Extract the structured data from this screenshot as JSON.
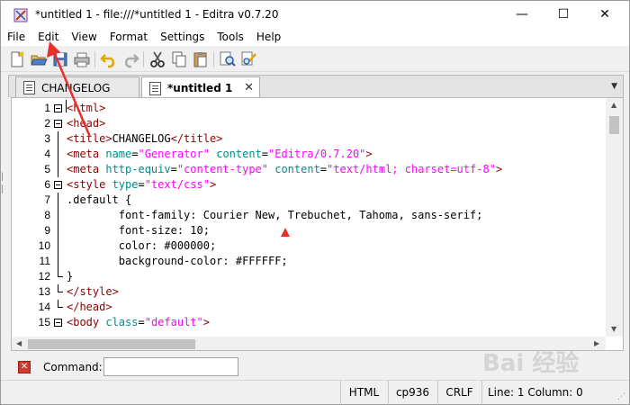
{
  "window": {
    "title": "*untitled 1 - file:///*untitled 1 - Editra v0.7.20",
    "minimize": "—",
    "maximize": "☐",
    "close": "✕"
  },
  "menu": [
    "File",
    "Edit",
    "View",
    "Format",
    "Settings",
    "Tools",
    "Help"
  ],
  "toolbar": {
    "buttons": [
      "new-file",
      "open-file",
      "save-file",
      "print",
      "undo",
      "redo",
      "cut",
      "copy",
      "paste",
      "find",
      "find-replace"
    ]
  },
  "tabs": [
    {
      "label": "CHANGELOG",
      "active": false
    },
    {
      "label": "*untitled 1",
      "active": true,
      "close": "✕"
    }
  ],
  "tab_menu": "▼",
  "editor": {
    "line_numbers": [
      "1",
      "2",
      "3",
      "4",
      "5",
      "6",
      "7",
      "8",
      "9",
      "10",
      "11",
      "12",
      "13",
      "14",
      "15"
    ],
    "lines": [
      [
        {
          "t": "<html>",
          "c": "tg"
        }
      ],
      [
        {
          "t": "<head>",
          "c": "tg"
        }
      ],
      [
        {
          "t": "<title>",
          "c": "tg"
        },
        {
          "t": "CHANGELOG",
          "c": "pl"
        },
        {
          "t": "</title>",
          "c": "tg"
        }
      ],
      [
        {
          "t": "<meta ",
          "c": "tg"
        },
        {
          "t": "name",
          "c": "at"
        },
        {
          "t": "=",
          "c": "pl"
        },
        {
          "t": "\"Generator\"",
          "c": "st"
        },
        {
          "t": " ",
          "c": "pl"
        },
        {
          "t": "content",
          "c": "at"
        },
        {
          "t": "=",
          "c": "pl"
        },
        {
          "t": "\"Editra/0.7.20\"",
          "c": "st"
        },
        {
          "t": ">",
          "c": "tg"
        }
      ],
      [
        {
          "t": "<meta ",
          "c": "tg"
        },
        {
          "t": "http-equiv",
          "c": "at"
        },
        {
          "t": "=",
          "c": "pl"
        },
        {
          "t": "\"content-type\"",
          "c": "st"
        },
        {
          "t": " ",
          "c": "pl"
        },
        {
          "t": "content",
          "c": "at"
        },
        {
          "t": "=",
          "c": "pl"
        },
        {
          "t": "\"text/html; charset=utf-8\"",
          "c": "st"
        },
        {
          "t": ">",
          "c": "tg"
        }
      ],
      [
        {
          "t": "<style ",
          "c": "tg"
        },
        {
          "t": "type",
          "c": "at"
        },
        {
          "t": "=",
          "c": "pl"
        },
        {
          "t": "\"text/css\"",
          "c": "st"
        },
        {
          "t": ">",
          "c": "tg"
        }
      ],
      [
        {
          "t": ".default {",
          "c": "pl"
        }
      ],
      [
        {
          "t": "        font-family: Courier New, Trebuchet, Tahoma, sans-serif;",
          "c": "pl"
        }
      ],
      [
        {
          "t": "        font-size: 10;",
          "c": "pl"
        }
      ],
      [
        {
          "t": "        color: #000000;",
          "c": "pl"
        }
      ],
      [
        {
          "t": "        background-color: #FFFFFF;",
          "c": "pl"
        }
      ],
      [
        {
          "t": "}",
          "c": "pl"
        }
      ],
      [
        {
          "t": "</style>",
          "c": "tg"
        }
      ],
      [
        {
          "t": "</head>",
          "c": "tg"
        }
      ],
      [
        {
          "t": "<body ",
          "c": "tg"
        },
        {
          "t": "class",
          "c": "at"
        },
        {
          "t": "=",
          "c": "pl"
        },
        {
          "t": "\"default\"",
          "c": "st"
        },
        {
          "t": ">",
          "c": "tg"
        }
      ]
    ]
  },
  "command": {
    "label": "Command:",
    "value": ""
  },
  "status": {
    "mode": "HTML",
    "encoding": "cp936",
    "eol": "CRLF",
    "position": "Line: 1  Column: 0"
  },
  "colors": {
    "tag": "#8b0000",
    "attribute": "#008b8b",
    "string": "#ff00ff",
    "annotation": "#e8302b"
  },
  "watermark": "Bai  经验"
}
